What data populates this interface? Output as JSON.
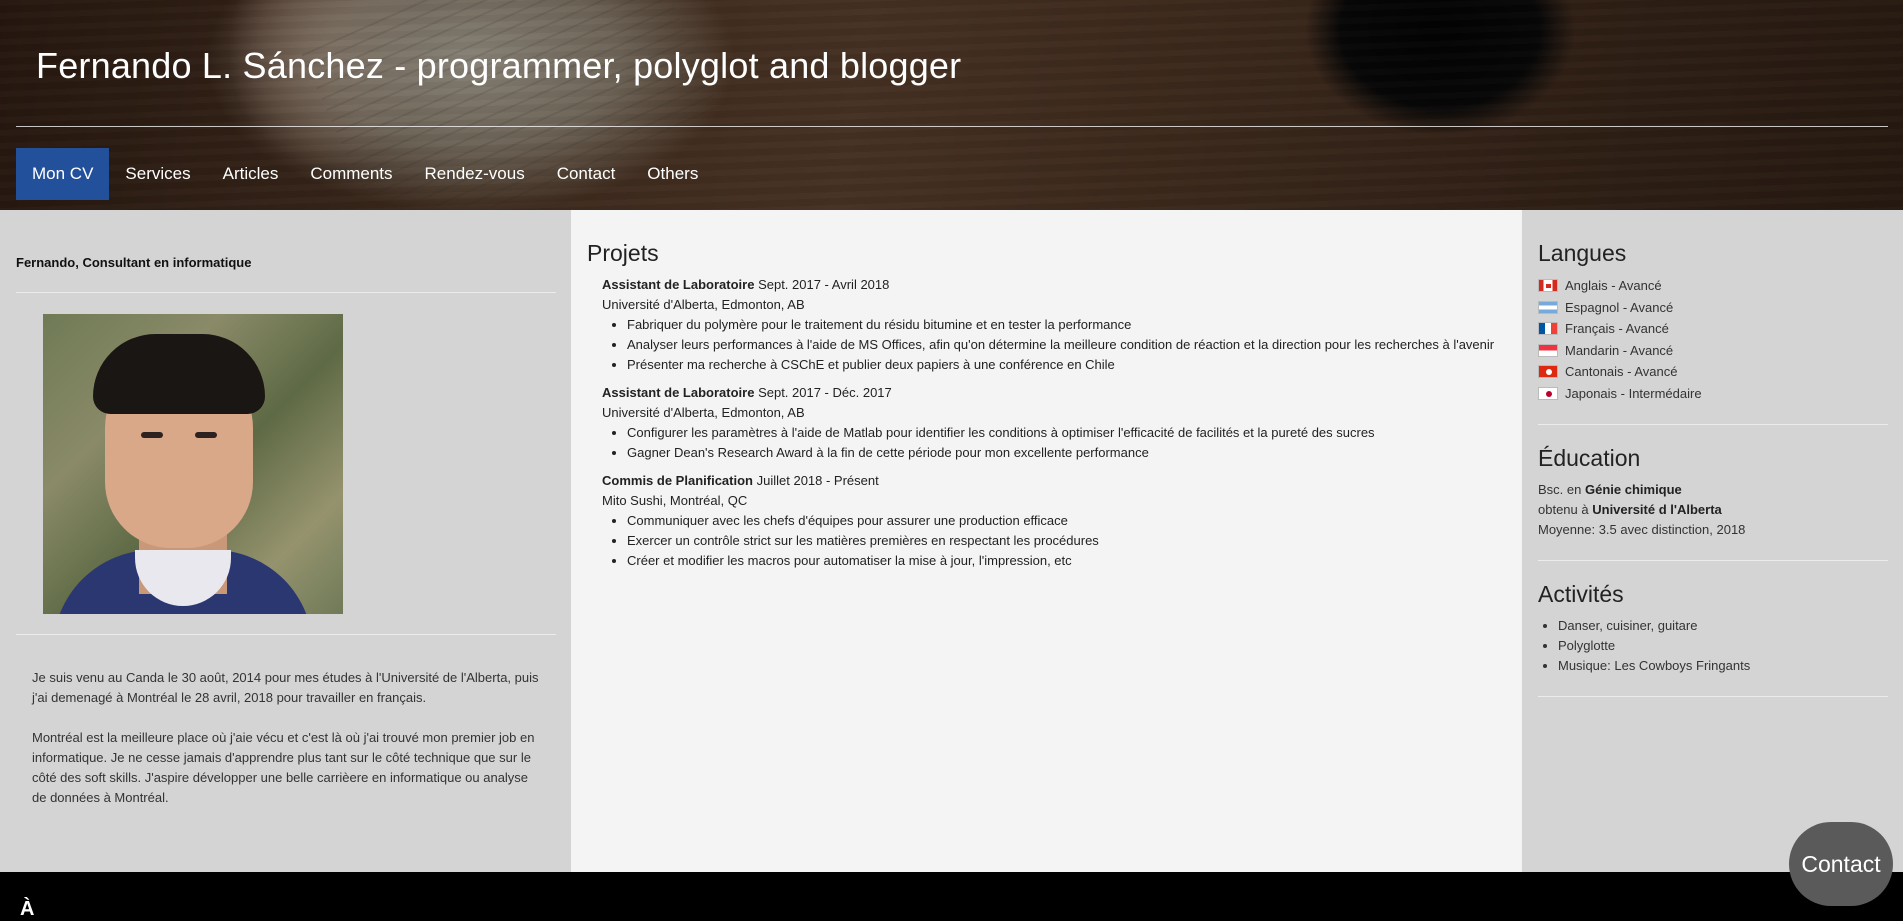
{
  "site": {
    "title": "Fernando L. Sánchez - programmer, polyglot and blogger",
    "nav": [
      {
        "label": "Mon CV",
        "active": true
      },
      {
        "label": "Services"
      },
      {
        "label": "Articles"
      },
      {
        "label": "Comments"
      },
      {
        "label": "Rendez-vous"
      },
      {
        "label": "Contact"
      },
      {
        "label": "Others"
      }
    ],
    "accent_color": "#23509b"
  },
  "left": {
    "heading": "Fernando, Consultant en informatique",
    "bio": [
      "Je suis venu au Canda le 30 août, 2014 pour mes études à l'Université de l'Alberta, puis j'ai demenagé à Montréal le 28 avril, 2018 pour travailler en français.",
      "Montréal est la meilleure place où j'aie vécu et c'est là où j'ai trouvé mon premier job en informatique. Je ne cesse jamais d'apprendre plus tant sur le côté technique que sur le côté des soft skills. J'aspire développer une belle carrièere en informatique ou analyse de données à Montréal."
    ]
  },
  "projects": {
    "title": "Projets",
    "jobs": [
      {
        "role": "Assistant de Laboratoire",
        "dates": "Sept. 2017 - Avril 2018",
        "place": "Université d'Alberta, Edmonton, AB",
        "bullets": [
          "Fabriquer du polymère pour le traitement du résidu bitumine et en tester la performance",
          "Analyser leurs performances à l'aide de MS Offices, afin qu'on détermine la meilleure condition de réaction et la direction pour les recherches à l'avenir",
          "Présenter ma recherche à CSChE et publier deux papiers à une conférence en Chile"
        ]
      },
      {
        "role": "Assistant de Laboratoire",
        "dates": "Sept. 2017 - Déc. 2017",
        "place": "Université d'Alberta, Edmonton, AB",
        "bullets": [
          "Configurer les paramètres à l'aide de Matlab pour identifier les conditions à optimiser l'efficacité de facilités et la pureté des sucres",
          "Gagner Dean's Research Award à la fin de cette période pour mon excellente performance"
        ]
      },
      {
        "role": "Commis de Planification",
        "dates": "Juillet 2018 - Présent",
        "place": "Mito Sushi, Montréal, QC",
        "bullets": [
          "Communiquer avec les chefs d'équipes pour assurer une production efficace",
          "Exercer un contrôle strict sur les matières premières en respectant les procédures",
          "Créer et modifier les macros pour automatiser la mise à jour, l'impression, etc"
        ]
      }
    ]
  },
  "languages": {
    "title": "Langues",
    "items": [
      {
        "flag": "canada-flag",
        "label": "Anglais - Avancé"
      },
      {
        "flag": "argentina-flag",
        "label": "Espagnol - Avancé"
      },
      {
        "flag": "france-flag",
        "label": "Français - Avancé"
      },
      {
        "flag": "singapore-flag",
        "label": "Mandarin - Avancé"
      },
      {
        "flag": "hong-kong-flag",
        "label": "Cantonais - Avancé"
      },
      {
        "flag": "japan-flag",
        "label": "Japonais - Intermédaire"
      }
    ]
  },
  "education": {
    "title": "Éducation",
    "degree_prefix": "Bsc. en",
    "degree": "Génie chimique",
    "school_prefix": "obtenu à",
    "school": "Université d l'Alberta",
    "gpa": "Moyenne: 3.5 avec distinction, 2018"
  },
  "activities": {
    "title": "Activités",
    "items": [
      "Danser, cuisiner, guitare",
      "Polyglotte",
      "Musique: Les Cowboys Fringants"
    ]
  },
  "floating": {
    "contact_label": "Contact"
  },
  "footer": {
    "partial_text": "À"
  }
}
